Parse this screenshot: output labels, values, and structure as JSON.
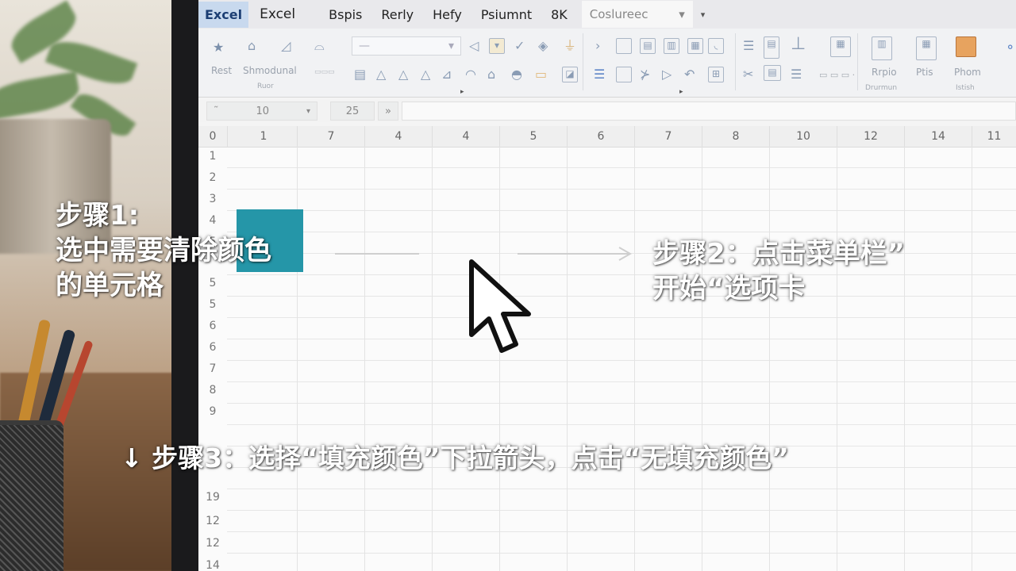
{
  "menubar": {
    "logo": "Excel",
    "items": [
      "Excel",
      "Bspis",
      "Rerly",
      "Hefy",
      "Psiumnt",
      "8K"
    ],
    "combo_value": "Coslureec"
  },
  "ribbon": {
    "labels": [
      "Rest",
      "Shmodunal",
      "Rrpio",
      "Ptis",
      "Phom"
    ],
    "sublabels": [
      "Ruor",
      "Drurmun",
      "Istish"
    ],
    "dropdown_value": "—"
  },
  "formula_bar": {
    "font_size": "10",
    "field2": "25"
  },
  "grid": {
    "column_headers": [
      "0",
      "1",
      "7",
      "4",
      "4",
      "5",
      "6",
      "7",
      "8",
      "10",
      "12",
      "14",
      "11"
    ],
    "row_headers": [
      "1",
      "2",
      "3",
      "4",
      "5",
      "5",
      "5",
      "6",
      "6",
      "7",
      "8",
      "9",
      "",
      "19",
      "12",
      "12",
      "14"
    ],
    "selected_cell_color": "#2596a8"
  },
  "annotations": {
    "step1": [
      "步骤1:",
      "选中需要清除颜色",
      "的单元格"
    ],
    "step2": [
      "步骤2：点击菜单栏”",
      "开始“选项卡"
    ],
    "step3_arrow": "↓",
    "step3": "步骤3：选择“填充颜色”下拉箭头，点击“无填充颜色”"
  }
}
